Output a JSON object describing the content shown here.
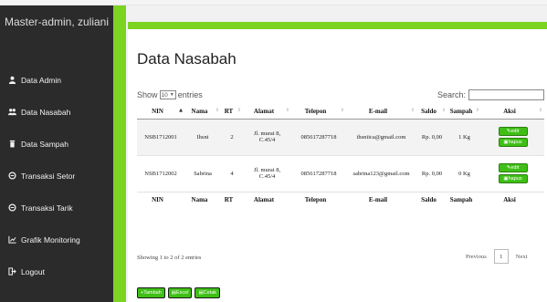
{
  "sidebar": {
    "user": "Master-admin, zuliani",
    "items": [
      {
        "label": "Data Admin"
      },
      {
        "label": "Data Nasabah"
      },
      {
        "label": "Data Sampah"
      },
      {
        "label": "Transaksi Setor"
      },
      {
        "label": "Transaksi Tarik"
      },
      {
        "label": "Grafik Monitoring"
      },
      {
        "label": "Logout"
      }
    ],
    "icons": [
      "user-icon",
      "users-icon",
      "trash-icon",
      "exchange-icon",
      "exchange-icon",
      "chart-icon",
      "logout-icon"
    ]
  },
  "colors": {
    "accent": "#7dd321",
    "sidebar_bg": "#2b2b2b",
    "button_bg": "#3fbf16"
  },
  "page": {
    "title": "Data Nasabah"
  },
  "controls": {
    "show_label": "Show",
    "entries_value": "10",
    "entries_label": "entries",
    "search_label": "Search:"
  },
  "table": {
    "columns": [
      "NIN",
      "Nama",
      "RT",
      "Alamat",
      "Telepon",
      "E-mail",
      "Saldo",
      "Sampah",
      "Aksi"
    ],
    "rows": [
      {
        "nin": "NSB1712001",
        "nama": "Ihsni",
        "rt": "2",
        "alamat_line1": "Jl. murai 8,",
        "alamat_line2": "C.45/4",
        "telepon": "085617287718",
        "email": "ihsniica@gmail.com",
        "saldo": "Rp. 0,00",
        "sampah": "1 Kg"
      },
      {
        "nin": "NSB1712002",
        "nama": "Sabrina",
        "rt": "4",
        "alamat_line1": "Jl. murai 8,",
        "alamat_line2": "C.45/4",
        "telepon": "085617287718",
        "email": "sabrina123@gmail.com",
        "saldo": "Rp. 0,00",
        "sampah": "0 Kg"
      }
    ],
    "edit_label": "edit",
    "hapus_label": "hapus"
  },
  "footer": {
    "info": "Showing 1 to 2 of 2 entries",
    "previous": "Previous",
    "page": "1",
    "next": "Next"
  },
  "actions": {
    "tambah": "Tambah",
    "excel": "Excel",
    "cetak": "Cetak"
  }
}
